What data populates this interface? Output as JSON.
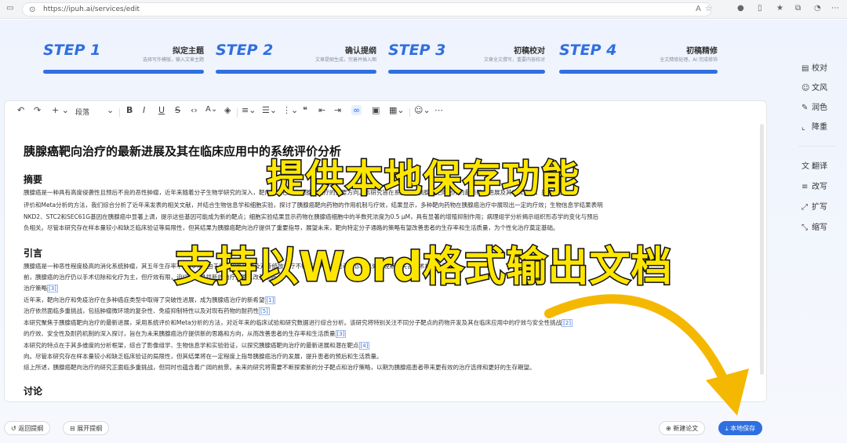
{
  "browser": {
    "url": "https://ipuh.ai/services/edit"
  },
  "steps": [
    {
      "num": "STEP 1",
      "title": "拟定主题",
      "desc": "选择写作模版，输入文章主题"
    },
    {
      "num": "STEP 2",
      "title": "确认提纲",
      "desc": "文章提纲生成，完善并插入图"
    },
    {
      "num": "STEP 3",
      "title": "初稿校对",
      "desc": "文章全文撰写，重要内容校对"
    },
    {
      "num": "STEP 4",
      "title": "初稿精修",
      "desc": "全文精修处理，AI 完成修饰"
    }
  ],
  "right_panel": {
    "items": [
      {
        "icon": "proofread-icon",
        "label": "校对"
      },
      {
        "icon": "references-icon",
        "label": "文风"
      },
      {
        "icon": "polish-icon",
        "label": "润色"
      },
      {
        "icon": "dedup-icon",
        "label": "降重"
      },
      {
        "icon": "translate-icon",
        "label": "翻译"
      },
      {
        "icon": "rewrite-icon",
        "label": "改写"
      },
      {
        "icon": "expand-icon",
        "label": "扩写"
      },
      {
        "icon": "abbreviate-icon",
        "label": "缩写"
      }
    ]
  },
  "toolbar": {
    "paragraph_label": "段落"
  },
  "document": {
    "title": "胰腺癌靶向治疗的最新进展及其在临床应用中的系统评价分析",
    "abstract_heading": "摘要",
    "abstract_lines": [
      "胰腺癌是一种具有高度侵袭性且预后不良的恶性肿瘤，近年来随着分子生物学研究的深入，靶向治疗已成为胰腺癌治疗的重要方向。本研究旨在系统评价胰腺癌靶向治疗的最新研究进展及其临床应用，采用系统",
      "评价和Meta分析的方法，我们综合分析了近年来发表的相关文献，并结合生物信息学和细胞实验，探讨了胰腺癌靶向药物的作用机制与疗效，结果显示，多种靶向药物在胰腺癌治疗中展现出一定的疗效；生物信息学结果表明",
      "NKD2、STC2和SEC61G基因在胰腺癌中显著上调，提示这些基因可能成为新的靶点；细胞实验结果显示药物在胰腺癌细胞中的半数死浓度为0.5 μM，具有显著的增殖抑制作用；病理组学分析揭示组织形态学的变化与预后",
      "负相关。尽管本研究存在样本量较小和缺乏临床验证等局限性，但其结果为胰腺癌靶向治疗提供了重要指导，展望未来，靶向特定分子通路的策略有望改善患者的生存率和生活质量，为个性化治疗奠定基础。"
    ],
    "intro_heading": "引言",
    "intro_lines": [
      {
        "text": "胰腺癌是一种恶性程度极高的消化系统肿瘤，其五年生存率不足10%，由于早期诊断困难及对传统放化疗不敏感，大多数患者确诊时已处于晚期，失去手术机会。",
        "cite": "[2]"
      },
      {
        "text": "前，胰腺癌的治疗仍以手术切除和化疗为主，但疗效有限，迫切需要寻找新的治疗策略以改善预后。",
        "cite": ""
      },
      {
        "text": "治疗策略",
        "cite": "[3]"
      },
      {
        "text": "近年来，靶向治疗和免疫治疗在多种癌症类型中取得了突破性进展，成为胰腺癌治疗的新希望",
        "cite": "[1]"
      },
      {
        "text": "治疗依然面临多重挑战，包括肿瘤微环境的复杂性、免疫抑制特性以及对现有药物的耐药性",
        "cite": "[5]"
      },
      {
        "text": "本研究聚焦于胰腺癌靶向治疗的最新进展，采用系统评价和Meta分析的方法，对近年来的临床试验和研究数据进行综合分析。该研究将特别关注不同分子靶点的药物开发及其在临床应用中的疗效与安全性挑战",
        "cite": "[2]"
      },
      {
        "text": "的疗效、安全性及耐药机制的深入探讨，旨在为未来胰腺癌治疗提供新的思路和方向，从而改善患者的生存率和生活质量",
        "cite": "[3]"
      },
      {
        "text": "本研究的特点在于其多维度的分析框架，综合了影像组学、生物信息学和实验验证，以探究胰腺癌靶向治疗的最新进展和潜在靶点",
        "cite": "[4]"
      },
      {
        "text": "向。尽管本研究存在样本量较小和缺乏临床验证的局限性，但其结果将在一定程度上指导胰腺癌治疗的发展，提升患者的预后和生活质量。",
        "cite": ""
      },
      {
        "text": "综上所述，胰腺癌靶向治疗的研究正面临多重挑战，但同时也蕴含着广阔的前景。未来的研究将需要不断探索新的分子靶点和治疗策略，以期为胰腺癌患者带来更有效的治疗选择和更好的生存期望。",
        "cite": ""
      }
    ],
    "discussion_heading": "讨论"
  },
  "overlay": {
    "line1": "提供本地保存功能",
    "line2": "支持以Word格式输出文档"
  },
  "bottom": {
    "back_label": "返回提纲",
    "expand_label": "展开提纲",
    "new_paper_label": "新建论文",
    "save_label": "本地保存"
  },
  "colors": {
    "accent": "#2f6fe0",
    "overlay_text": "#ffe600",
    "arrow": "#f5b800"
  }
}
